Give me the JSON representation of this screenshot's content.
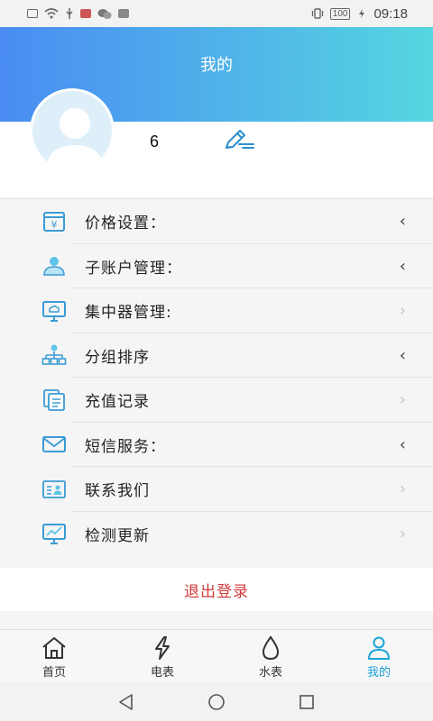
{
  "status_bar": {
    "time": "09:18",
    "battery": "100"
  },
  "header": {
    "title": "我的"
  },
  "profile": {
    "username": "6"
  },
  "menu": {
    "items": [
      {
        "label": "价格设置：",
        "icon": "price-icon",
        "chevron": "‹"
      },
      {
        "label": "子账户管理：",
        "icon": "user-icon",
        "chevron": "‹"
      },
      {
        "label": "集中器管理:",
        "icon": "monitor-cloud-icon",
        "chevron": "›"
      },
      {
        "label": "分组排序",
        "icon": "hierarchy-icon",
        "chevron": "‹"
      },
      {
        "label": "充值记录",
        "icon": "records-icon",
        "chevron": "›"
      },
      {
        "label": "短信服务：",
        "icon": "mail-icon",
        "chevron": "‹"
      },
      {
        "label": "联系我们",
        "icon": "contact-card-icon",
        "chevron": "›"
      },
      {
        "label": "检测更新",
        "icon": "monitor-chart-icon",
        "chevron": "›"
      }
    ]
  },
  "logout": {
    "label": "退出登录"
  },
  "tabbar": {
    "tabs": [
      {
        "label": "首页",
        "icon": "home-icon"
      },
      {
        "label": "电表",
        "icon": "lightning-icon"
      },
      {
        "label": "水表",
        "icon": "water-drop-icon"
      },
      {
        "label": "我的",
        "icon": "person-icon"
      }
    ]
  },
  "colors": {
    "accent": "#1aa5d8",
    "header_start": "#4a8cf3",
    "header_end": "#55d6e0",
    "logout": "#d03a3a"
  }
}
